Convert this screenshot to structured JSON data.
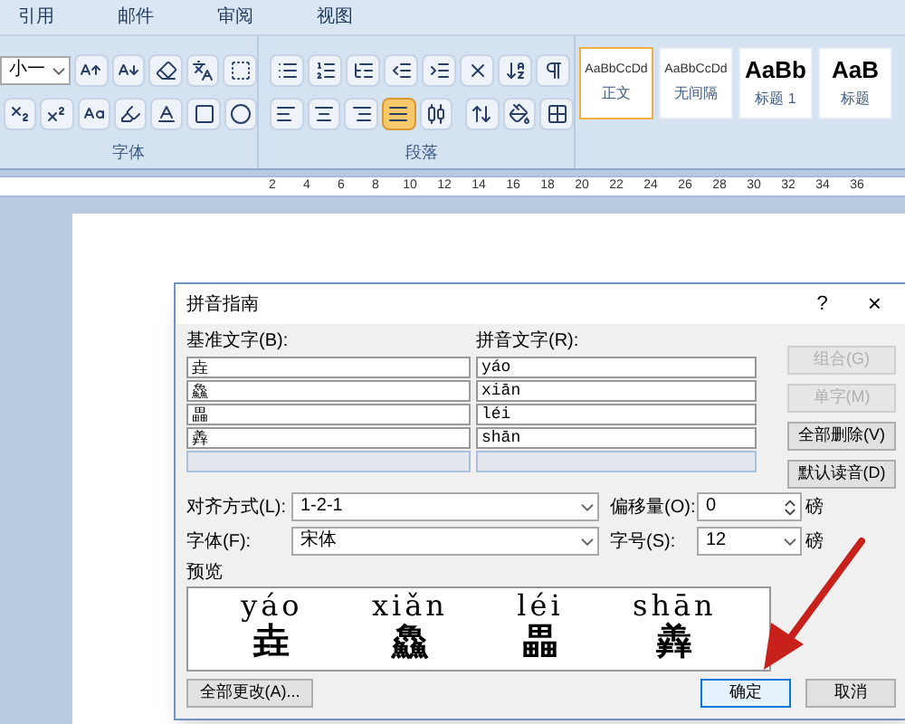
{
  "ribbon_tabs": [
    {
      "label": "引用",
      "selected": false
    },
    {
      "label": "邮件",
      "selected": false
    },
    {
      "label": "审阅",
      "selected": false
    },
    {
      "label": "视图",
      "selected": false
    }
  ],
  "font_group": {
    "label": "字体",
    "size_value": "小一",
    "row1": [
      {
        "kind": "grow"
      },
      {
        "kind": "shrink"
      },
      {
        "kind": "clear"
      },
      {
        "kind": "phonetic"
      },
      {
        "kind": "border"
      }
    ],
    "row2": [
      {
        "kind": "subscript"
      },
      {
        "kind": "superscript"
      },
      {
        "kind": "case"
      },
      {
        "kind": "highlight"
      },
      {
        "kind": "color"
      },
      {
        "kind": "shading"
      },
      {
        "kind": "enclose"
      }
    ]
  },
  "paragraph_group": {
    "label": "段落",
    "row1": [
      {
        "kind": "bullets"
      },
      {
        "kind": "numbering"
      },
      {
        "kind": "multilevel"
      },
      {
        "kind": "outdent"
      },
      {
        "kind": "indent"
      },
      {
        "kind": "asian"
      },
      {
        "kind": "sort"
      },
      {
        "kind": "marks"
      }
    ],
    "align": [
      {
        "kind": "left",
        "selected": false
      },
      {
        "kind": "center",
        "selected": false
      },
      {
        "kind": "right",
        "selected": false
      },
      {
        "kind": "justify",
        "selected": true
      },
      {
        "kind": "distribute",
        "selected": false
      }
    ],
    "row2": [
      {
        "kind": "spacing"
      },
      {
        "kind": "fill"
      },
      {
        "kind": "borders"
      }
    ]
  },
  "styles": [
    {
      "sample": "AaBbCcDd",
      "name": "正文",
      "kind": "body",
      "selected": true
    },
    {
      "sample": "AaBbCcDd",
      "name": "无间隔",
      "kind": "body",
      "selected": false
    },
    {
      "sample": "AaBb",
      "name": "标题 1",
      "kind": "heading",
      "selected": false
    },
    {
      "sample": "AaB",
      "name": "标题",
      "kind": "heading",
      "selected": false
    }
  ],
  "ruler": [
    "2",
    "4",
    "6",
    "8",
    "10",
    "12",
    "14",
    "16",
    "18",
    "20",
    "22",
    "24",
    "26",
    "28",
    "30",
    "32",
    "34",
    "36"
  ],
  "dialog": {
    "title": "拼音指南",
    "help": "?",
    "close": "×",
    "base_label": "基准文字(B):",
    "ruby_label": "拼音文字(R):",
    "rows": [
      {
        "base": "垚",
        "ruby": "yáo"
      },
      {
        "base": "鱻",
        "ruby": "xiān"
      },
      {
        "base": "畾",
        "ruby": "léi"
      },
      {
        "base": "羴",
        "ruby": "shān"
      },
      {
        "base": "",
        "ruby": ""
      }
    ],
    "side_buttons": [
      {
        "label": "组合(G)",
        "disabled": true
      },
      {
        "label": "单字(M)",
        "disabled": true
      },
      {
        "label": "全部删除(V)",
        "disabled": false
      },
      {
        "label": "默认读音(D)",
        "disabled": false
      }
    ],
    "align_label": "对齐方式(L):",
    "align_value": "1-2-1",
    "offset_label": "偏移量(O):",
    "offset_value": "0",
    "offset_unit": "磅",
    "font_label": "字体(F):",
    "font_value": "宋体",
    "size_label": "字号(S):",
    "size_value": "12",
    "size_unit": "磅",
    "preview_label": "预览",
    "preview": [
      {
        "ruby": "yáo",
        "base": "垚"
      },
      {
        "ruby": "xiǎn",
        "base": "鱻"
      },
      {
        "ruby": "léi",
        "base": "畾"
      },
      {
        "ruby": "shān",
        "base": "羴"
      }
    ],
    "change_all": "全部更改(A)...",
    "ok": "确定",
    "cancel": "取消"
  }
}
